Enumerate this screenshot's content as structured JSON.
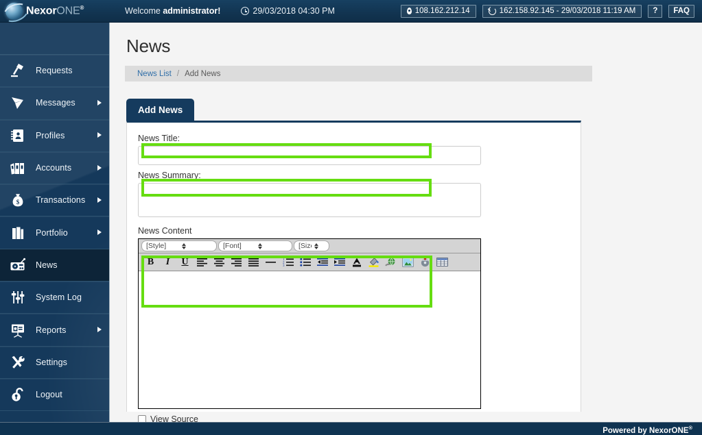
{
  "brand": {
    "name_bold": "Nexor",
    "name_light": "ONE",
    "reg": "®",
    "logo_icon": "nexor-orb-logo"
  },
  "topbar": {
    "welcome_prefix": "Welcome ",
    "welcome_user": "administrator!",
    "clock_icon": "clock-icon",
    "datetime": "29/03/2018 04:30 PM",
    "ip_chip": {
      "icon": "location-pin-icon",
      "text": "108.162.212.14"
    },
    "last_login_chip": {
      "icon": "history-revert-icon",
      "text": "162.158.92.145 - 29/03/2018 11:19 AM"
    },
    "help_button": "?",
    "faq_button": "FAQ"
  },
  "sidebar": {
    "items": [
      {
        "label": "Requests",
        "icon": "desk-lamp-icon",
        "has_submenu": false,
        "active": false
      },
      {
        "label": "Messages",
        "icon": "paper-plane-icon",
        "has_submenu": true,
        "active": false
      },
      {
        "label": "Profiles",
        "icon": "address-book-icon",
        "has_submenu": true,
        "active": false
      },
      {
        "label": "Accounts",
        "icon": "binders-icon",
        "has_submenu": true,
        "active": false
      },
      {
        "label": "Transactions",
        "icon": "money-bag-icon",
        "has_submenu": true,
        "active": false
      },
      {
        "label": "Portfolio",
        "icon": "briefcase-icon",
        "has_submenu": true,
        "active": false
      },
      {
        "label": "News",
        "icon": "radio-icon",
        "has_submenu": false,
        "active": true
      },
      {
        "label": "System Log",
        "icon": "sliders-icon",
        "has_submenu": false,
        "active": false
      },
      {
        "label": "Reports",
        "icon": "presentation-icon",
        "has_submenu": true,
        "active": false
      },
      {
        "label": "Settings",
        "icon": "tools-icon",
        "has_submenu": false,
        "active": false
      },
      {
        "label": "Logout",
        "icon": "padlock-open-icon",
        "has_submenu": false,
        "active": false
      }
    ]
  },
  "main": {
    "page_title": "News",
    "breadcrumb": {
      "link": "News List",
      "separator": "/",
      "current": "Add News"
    },
    "tab_label": "Add News",
    "form": {
      "title_label": "News Title:",
      "title_value": "",
      "summary_label": "News Summary:",
      "summary_value": "",
      "content_label": "News Content",
      "content_value": "",
      "view_source_label": "View Source"
    },
    "editor": {
      "style_select": "[Style]",
      "font_select": "[Font]",
      "size_select": "[Size]",
      "tools": [
        {
          "name": "bold-icon",
          "glyph": "B"
        },
        {
          "name": "italic-icon",
          "glyph": "I"
        },
        {
          "name": "underline-icon",
          "glyph": "U"
        },
        {
          "name": "align-left-icon",
          "glyph": ""
        },
        {
          "name": "align-center-icon",
          "glyph": ""
        },
        {
          "name": "align-right-icon",
          "glyph": ""
        },
        {
          "name": "align-justify-icon",
          "glyph": ""
        },
        {
          "name": "horizontal-rule-icon",
          "glyph": ""
        },
        {
          "name": "ordered-list-icon",
          "glyph": ""
        },
        {
          "name": "unordered-list-icon",
          "glyph": ""
        },
        {
          "name": "outdent-icon",
          "glyph": ""
        },
        {
          "name": "indent-icon",
          "glyph": ""
        },
        {
          "name": "font-color-icon",
          "glyph": ""
        },
        {
          "name": "highlight-color-icon",
          "glyph": ""
        },
        {
          "name": "insert-link-icon",
          "glyph": ""
        },
        {
          "name": "insert-image-icon",
          "glyph": ""
        },
        {
          "name": "insert-flash-icon",
          "glyph": ""
        },
        {
          "name": "insert-table-icon",
          "glyph": ""
        }
      ]
    }
  },
  "footer": {
    "text": "Powered by NexorONE",
    "reg": "®"
  },
  "colors": {
    "brand_navy": "#15395b",
    "topbar_navy": "#123552",
    "active_nav": "#0d2438",
    "tab_navy": "#153b5e",
    "breadcrumb_link": "#2f6ea8",
    "page_bg": "#f4f4f4",
    "highlight_green": "#66dd11"
  }
}
